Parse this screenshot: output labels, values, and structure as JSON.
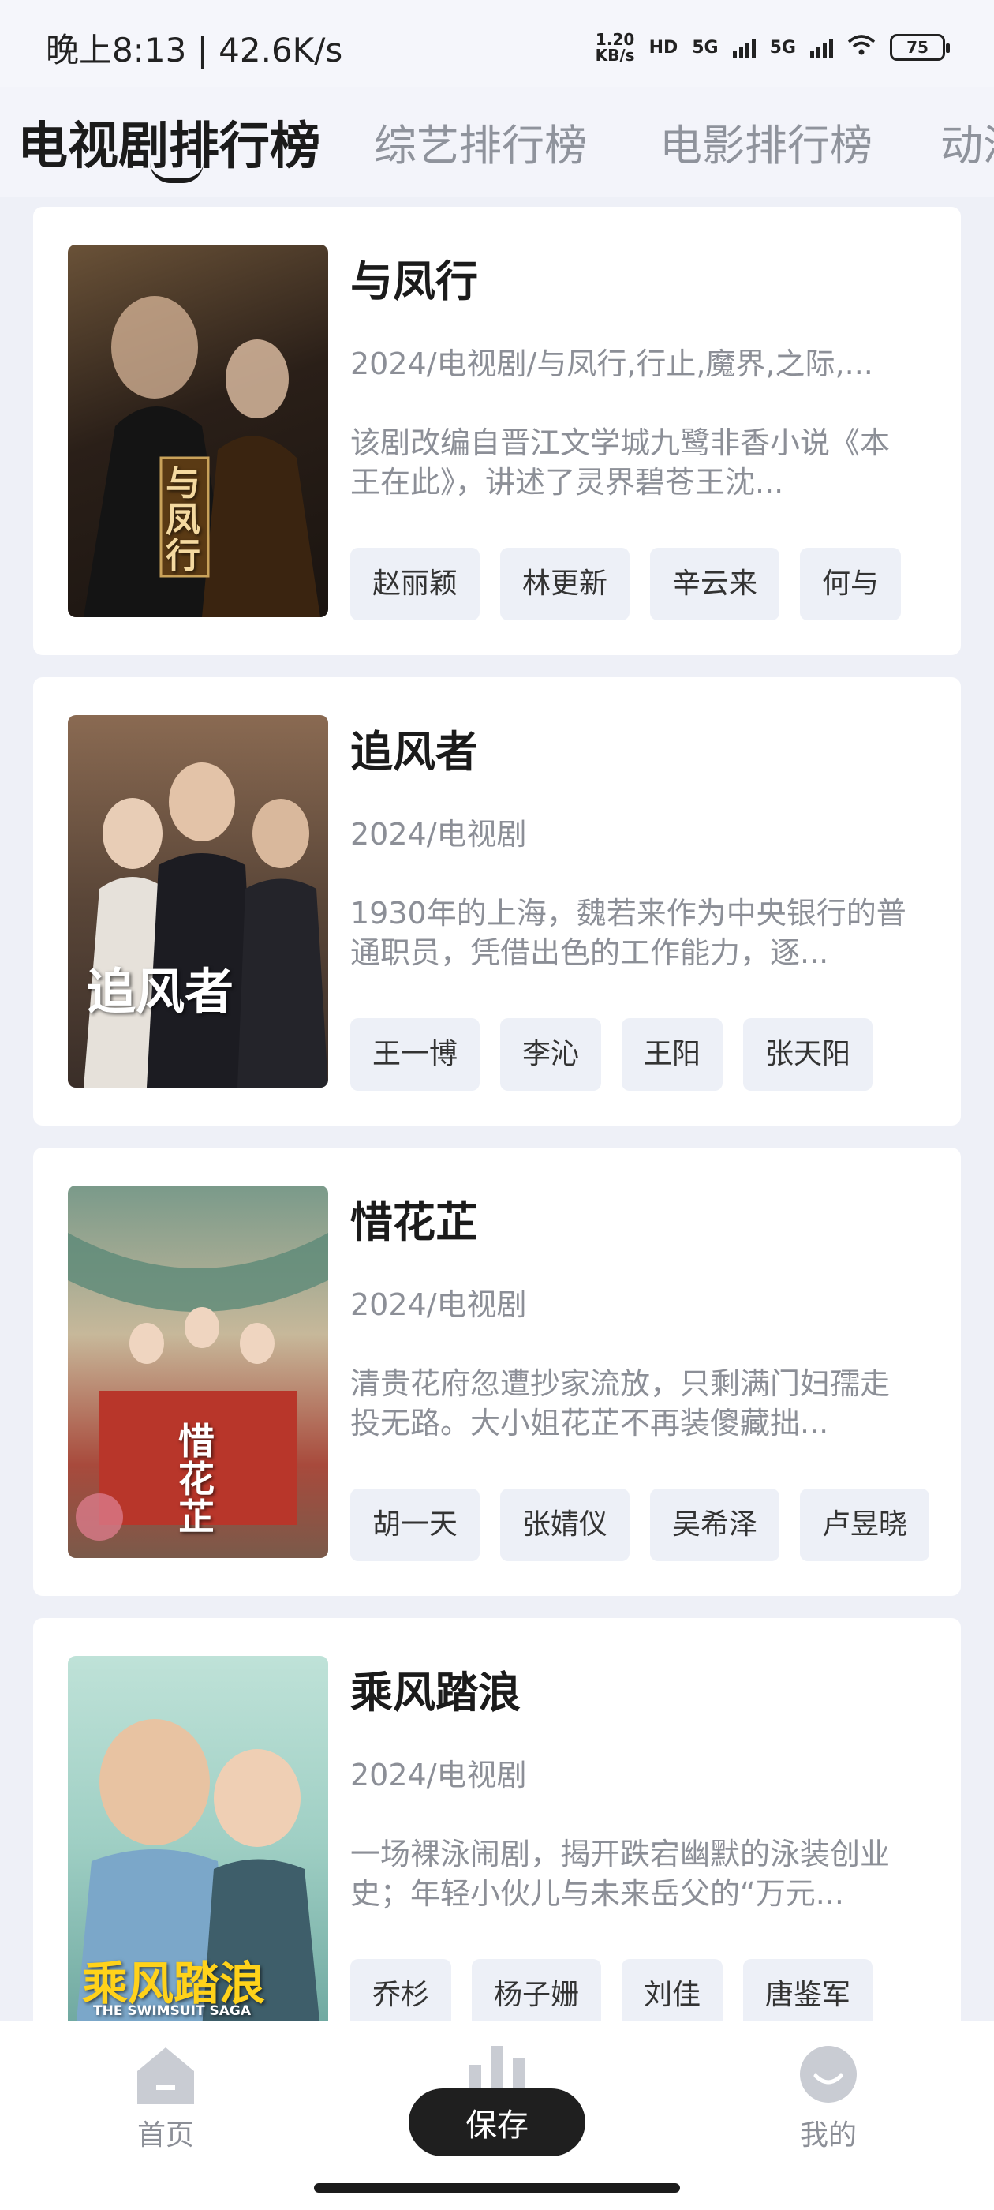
{
  "status_bar": {
    "time": "晚上8:13 | 42.6K/s",
    "speed_value": "1.20",
    "speed_unit": "KB/s",
    "hd_label": "HD",
    "net1": "5G",
    "net2": "5G",
    "battery": "75"
  },
  "tabs": [
    {
      "label": "电视剧排行榜"
    },
    {
      "label": "综艺排行榜"
    },
    {
      "label": "电影排行榜"
    },
    {
      "label": "动漫"
    }
  ],
  "cards": [
    {
      "title": "与凤行",
      "poster_text": "与凤行",
      "meta": "2024/电视剧/与凤行,行止,魔界,之际,...",
      "desc": "该剧改编自晋江文学城九鹭非香小说《本王在此》，讲述了灵界碧苍王沈...",
      "tags": [
        "赵丽颖",
        "林更新",
        "辛云来",
        "何与"
      ]
    },
    {
      "title": "追风者",
      "poster_text": "追风者",
      "meta": "2024/电视剧",
      "desc": "1930年的上海，魏若来作为中央银行的普通职员，凭借出色的工作能力，逐...",
      "tags": [
        "王一博",
        "李沁",
        "王阳",
        "张天阳"
      ]
    },
    {
      "title": "惜花芷",
      "poster_text": "惜花芷",
      "meta": "2024/电视剧",
      "desc": "清贵花府忽遭抄家流放，只剩满门妇孺走投无路。大小姐花芷不再装傻藏拙...",
      "tags": [
        "胡一天",
        "张婧仪",
        "吴希泽",
        "卢昱晓"
      ]
    },
    {
      "title": "乘风踏浪",
      "poster_text": "乘风踏浪",
      "poster_subtext": "THE SWIMSUIT SAGA",
      "meta": "2024/电视剧",
      "desc": "一场裸泳闹剧，揭开跌宕幽默的泳装创业史；年轻小伙儿与未来岳父的“万元...",
      "tags": [
        "乔杉",
        "杨子姗",
        "刘佳",
        "唐鉴军"
      ]
    }
  ],
  "bottom_nav": {
    "home_label": "首页",
    "save_label": "保存",
    "mine_label": "我的"
  },
  "colors": {
    "background": "#eef0f7",
    "card": "#ffffff",
    "tag_bg": "#edf0f7",
    "muted_text": "#8c8f97",
    "save_button": "#1f1f1f"
  }
}
